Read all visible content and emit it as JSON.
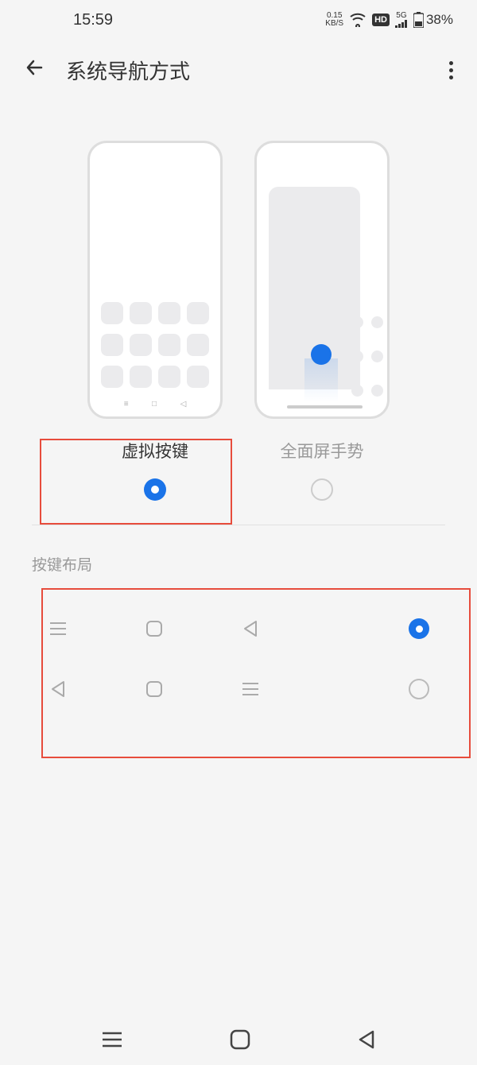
{
  "statusBar": {
    "time": "15:59",
    "speedValue": "0.15",
    "speedUnit": "KB/S",
    "hd": "HD",
    "network": "5G",
    "battery": "38%"
  },
  "header": {
    "title": "系统导航方式"
  },
  "navOptions": {
    "virtualKeys": {
      "label": "虚拟按键",
      "selected": true
    },
    "gesture": {
      "label": "全面屏手势",
      "selected": false
    }
  },
  "layoutSection": {
    "label": "按键布局",
    "options": [
      {
        "order": [
          "menu",
          "home",
          "back"
        ],
        "selected": true
      },
      {
        "order": [
          "back",
          "home",
          "menu"
        ],
        "selected": false
      }
    ]
  }
}
